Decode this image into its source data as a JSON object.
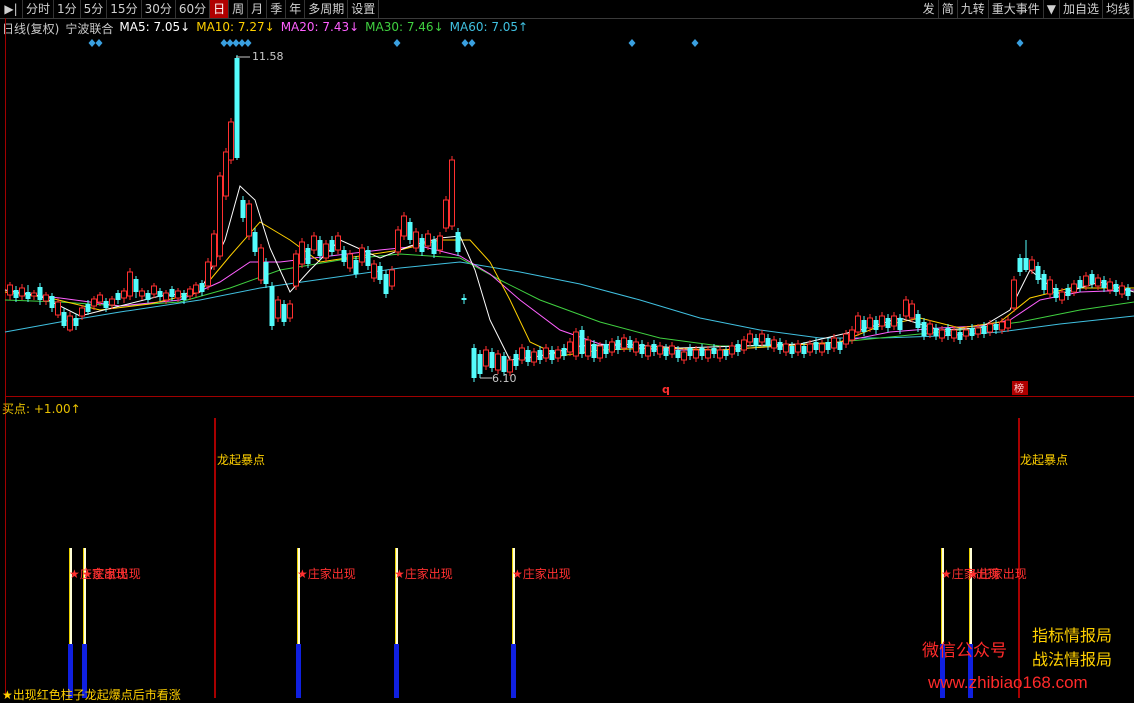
{
  "toolbar": {
    "left_items": [
      "分时",
      "1分",
      "5分",
      "15分",
      "30分",
      "60分",
      "日",
      "周",
      "月",
      "季",
      "年",
      "多周期",
      "设置"
    ],
    "active": "日",
    "right_items": [
      "发",
      "简",
      "九转",
      "重大事件",
      "▼",
      "加自选",
      "均线"
    ]
  },
  "info": {
    "period": "日线(复权)",
    "stock": "宁波联合",
    "ma5": "MA5: 7.05↓",
    "ma10": "MA10: 7.27↓",
    "ma20": "MA20: 7.43↓",
    "ma30": "MA30: 7.46↓",
    "ma60": "MA60: 7.05↑"
  },
  "colors": {
    "ma5": "#ffffff",
    "ma10": "#ffd000",
    "ma20": "#ff60ff",
    "ma30": "#40d040",
    "ma60": "#40c0e0",
    "up": "#ff3030",
    "down": "#54fcfc"
  },
  "price_labels": {
    "high": "11.58",
    "low": "6.10"
  },
  "markers": {
    "q": "q",
    "bang": "榜"
  },
  "indicator": {
    "label": "买点:",
    "value": "+1.00↑"
  },
  "signals": {
    "dragon": "龙起暴点",
    "zhuang": "★庄家出现",
    "overlap_a": "★庄家出现",
    "overlap_b": "★庄家出现",
    "bottom": "★出现红色柱子龙起爆点后市看涨"
  },
  "watermark": {
    "wechat": "微信公众号",
    "brand1": "指标情报局",
    "brand2": "战法情报局",
    "site": "www.zhibiao168.com"
  },
  "chart_data": {
    "type": "candlestick",
    "price_range": [
      6.1,
      11.58
    ],
    "price_high": 11.58,
    "price_low": 6.1,
    "ma": {
      "MA5": 7.05,
      "MA10": 7.27,
      "MA20": 7.43,
      "MA30": 7.46,
      "MA60": 7.05
    }
  }
}
